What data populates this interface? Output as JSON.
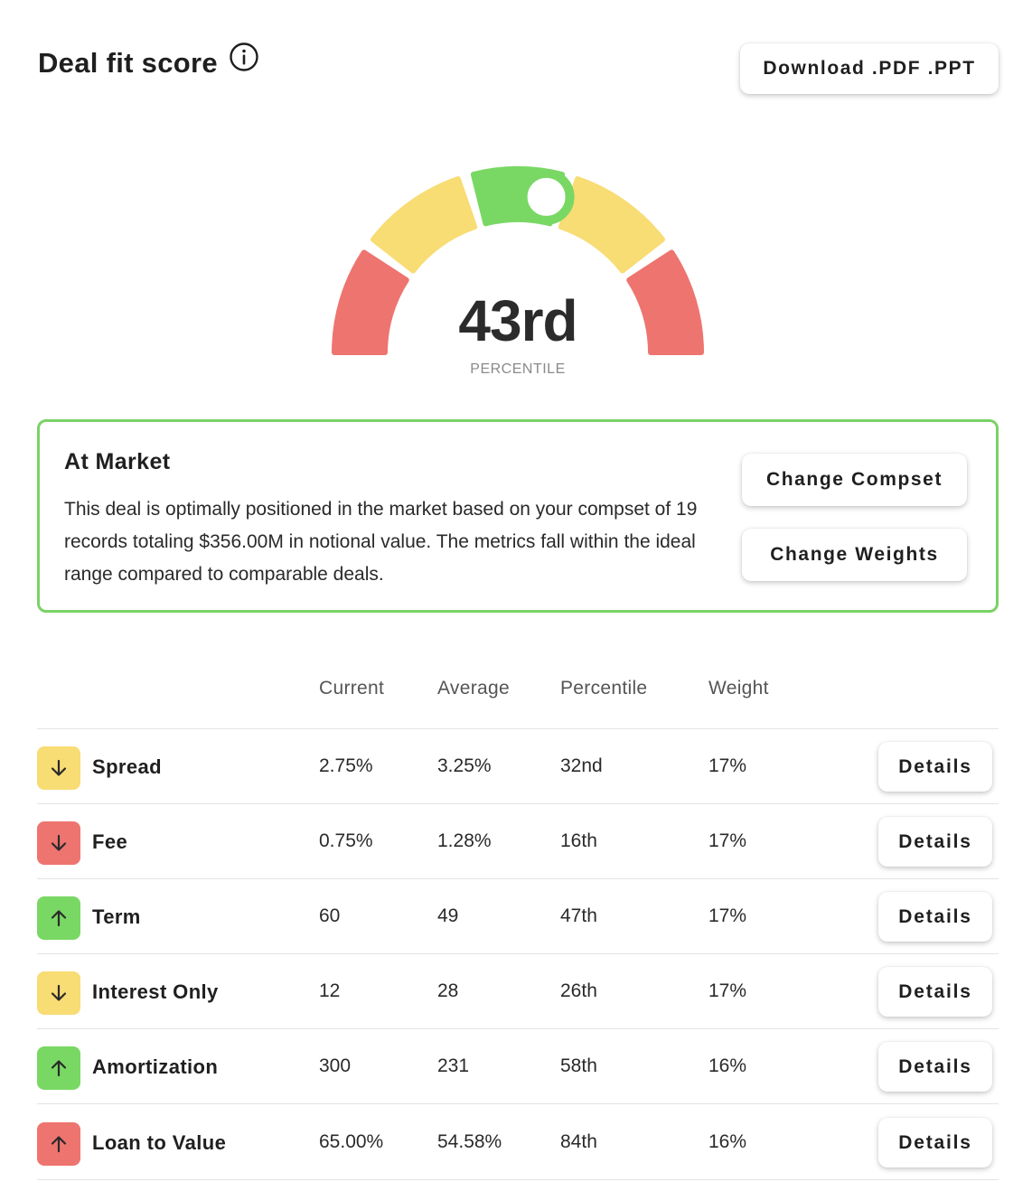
{
  "header": {
    "title": "Deal fit score",
    "download_label": "Download .PDF .PPT"
  },
  "gauge": {
    "score": "43rd",
    "label": "PERCENTILE",
    "percentile_value": 43,
    "segments": [
      {
        "color": "#ee7470"
      },
      {
        "color": "#f8dc74"
      },
      {
        "color": "#79d864"
      },
      {
        "color": "#f8dc74"
      },
      {
        "color": "#ee7470"
      }
    ],
    "marker_color": "#79d864"
  },
  "status": {
    "title": "At Market",
    "description": "This deal is optimally positioned in the market based on your compset of 19 records totaling $356.00M in notional value. The metrics fall within the ideal range compared to comparable deals.",
    "change_compset_label": "Change Compset",
    "change_weights_label": "Change Weights",
    "border_color": "#7bd266"
  },
  "table": {
    "headers": [
      "Current",
      "Average",
      "Percentile",
      "Weight"
    ],
    "details_label": "Details",
    "rows": [
      {
        "name": "Spread",
        "current": "2.75%",
        "average": "3.25%",
        "percentile": "32nd",
        "weight": "17%",
        "indicator": "arrow-down-icon",
        "color": "#f8dc74"
      },
      {
        "name": "Fee",
        "current": "0.75%",
        "average": "1.28%",
        "percentile": "16th",
        "weight": "17%",
        "indicator": "arrow-down-icon",
        "color": "#ee7470"
      },
      {
        "name": "Term",
        "current": "60",
        "average": "49",
        "percentile": "47th",
        "weight": "17%",
        "indicator": "arrow-up-icon",
        "color": "#79d864"
      },
      {
        "name": "Interest Only",
        "current": "12",
        "average": "28",
        "percentile": "26th",
        "weight": "17%",
        "indicator": "arrow-down-icon",
        "color": "#f8dc74"
      },
      {
        "name": "Amortization",
        "current": "300",
        "average": "231",
        "percentile": "58th",
        "weight": "16%",
        "indicator": "arrow-up-icon",
        "color": "#79d864"
      },
      {
        "name": "Loan to Value",
        "current": "65.00%",
        "average": "54.58%",
        "percentile": "84th",
        "weight": "16%",
        "indicator": "arrow-up-icon",
        "color": "#ee7470"
      }
    ]
  }
}
